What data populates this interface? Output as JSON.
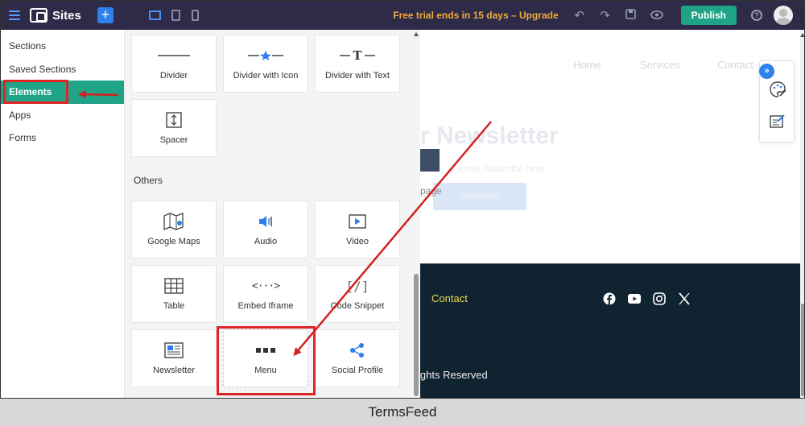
{
  "topbar": {
    "app_name": "Sites",
    "plus_label": "+",
    "trial_text": "Free trial ends in 15 days – Upgrade",
    "publish_label": "Publish",
    "help_label": "?"
  },
  "sidebar": {
    "items": [
      {
        "label": "Sections"
      },
      {
        "label": "Saved Sections"
      },
      {
        "label": "Elements"
      },
      {
        "label": "Apps"
      },
      {
        "label": "Forms"
      }
    ]
  },
  "panel": {
    "cards_top": [
      {
        "label": "Divider",
        "icon": "divider-icon"
      },
      {
        "label": "Divider with Icon",
        "icon": "divider-star-icon"
      },
      {
        "label": "Divider with Text",
        "icon": "divider-text-icon",
        "glyph": "T"
      },
      {
        "label": "Spacer",
        "icon": "spacer-icon"
      }
    ],
    "others_title": "Others",
    "cards_others": [
      {
        "label": "Google Maps",
        "icon": "map-icon"
      },
      {
        "label": "Audio",
        "icon": "audio-icon"
      },
      {
        "label": "Video",
        "icon": "video-icon"
      },
      {
        "label": "Table",
        "icon": "table-icon"
      },
      {
        "label": "Embed Iframe",
        "icon": "iframe-icon",
        "glyph": "<···>"
      },
      {
        "label": "Code Snippet",
        "icon": "code-icon",
        "glyph": "[/]"
      },
      {
        "label": "Newsletter",
        "icon": "newsletter-icon"
      },
      {
        "label": "Menu",
        "icon": "menu-icon"
      },
      {
        "label": "Social Profile",
        "icon": "share-icon"
      }
    ]
  },
  "canvas": {
    "nav": [
      "Home",
      "Services",
      "Contact"
    ],
    "newsletter_title": "r Newsletter",
    "ghost_email": "ur email, Subscribe here",
    "page_text": "page",
    "subscribe_label": "Subscribe",
    "footer_contact": "Contact",
    "footer_rights": "ights Reserved",
    "float_toggle": "»"
  },
  "caption": "TermsFeed",
  "colors": {
    "topbar": "#2d2b48",
    "accent_green": "#1fa487",
    "accent_blue": "#2f80ed",
    "trial_orange": "#f2a93b",
    "highlight_red": "#e02424",
    "footer_dark": "#0f2330"
  }
}
